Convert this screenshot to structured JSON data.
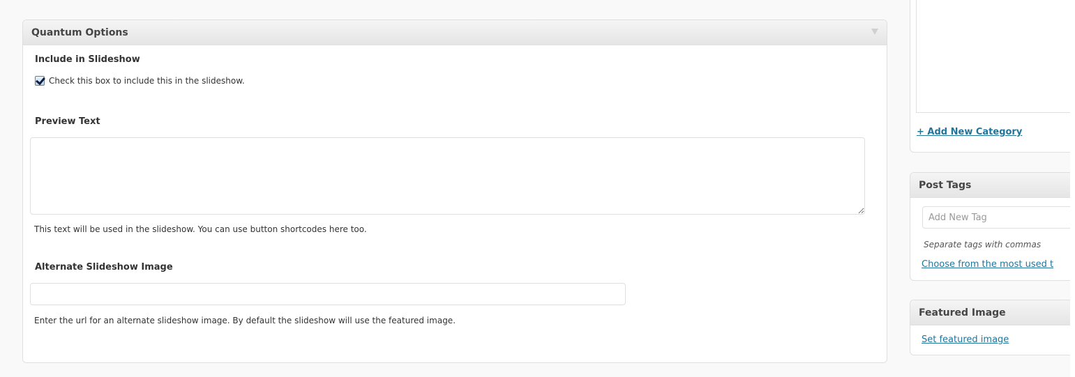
{
  "quantum_options": {
    "title": "Quantum Options",
    "include_label": "Include in Slideshow",
    "include_checkbox_checked": true,
    "include_checkbox_text": "Check this box to include this in the slideshow.",
    "preview_label": "Preview Text",
    "preview_value": "",
    "preview_help": "This text will be used in the slideshow. You can use button shortcodes here too.",
    "alt_image_label": "Alternate Slideshow Image",
    "alt_image_value": "",
    "alt_image_help": "Enter the url for an alternate slideshow image. By default the slideshow will use the featured image."
  },
  "categories": {
    "add_new_label": "+ Add New Category"
  },
  "post_tags": {
    "title": "Post Tags",
    "input_placeholder": "Add New Tag",
    "hint": "Separate tags with commas",
    "choose_link": "Choose from the most used t"
  },
  "featured_image": {
    "title": "Featured Image",
    "set_link": "Set featured image"
  },
  "colors": {
    "link": "#21759b",
    "header_bg": "#e5e5e5",
    "border": "#dfdfdf"
  }
}
